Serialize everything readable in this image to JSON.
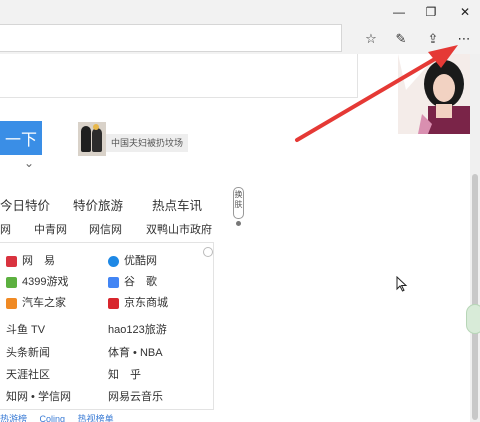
{
  "window": {
    "minimize_glyph": "—",
    "maximize_glyph": "❐",
    "close_glyph": "✕"
  },
  "toolbar": {
    "favorite_glyph": "☆",
    "notes_glyph": "✎",
    "share_glyph": "⇪",
    "more_glyph": "⋯"
  },
  "search": {
    "button_label": "一下",
    "suggest_chevron": "⌄"
  },
  "news": {
    "caption": "中国夫妇被扔坟场"
  },
  "hot_links": [
    "今日特价",
    "特价旅游",
    "热点车讯"
  ],
  "sub_links": [
    "网",
    "中青网",
    "网信网",
    "双鸭山市政府"
  ],
  "change_label": "换肤",
  "sites": [
    {
      "label": "网　易",
      "icon_color": "#d9333f"
    },
    {
      "label": "优酷网",
      "icon_color": "#1e88e5"
    },
    {
      "label": "4399游戏",
      "icon_color": "#5cb03f"
    },
    {
      "label": "谷　歌",
      "icon_color": "#4285f4"
    },
    {
      "label": "汽车之家",
      "icon_color": "#f08a24"
    },
    {
      "label": "京东商城",
      "icon_color": "#d8262d"
    }
  ],
  "plain_sites": [
    "斗鱼 TV",
    "hao123旅游",
    "头条新闻",
    "体育 • NBA",
    "天涯社区",
    "知　乎",
    "知网 • 学信网",
    "网易云音乐"
  ],
  "bottom_links": [
    "热游榜",
    "Coling",
    "热视榜单"
  ],
  "colors": {
    "accent": "#3a8ee6",
    "annotation_arrow": "#e53935"
  }
}
